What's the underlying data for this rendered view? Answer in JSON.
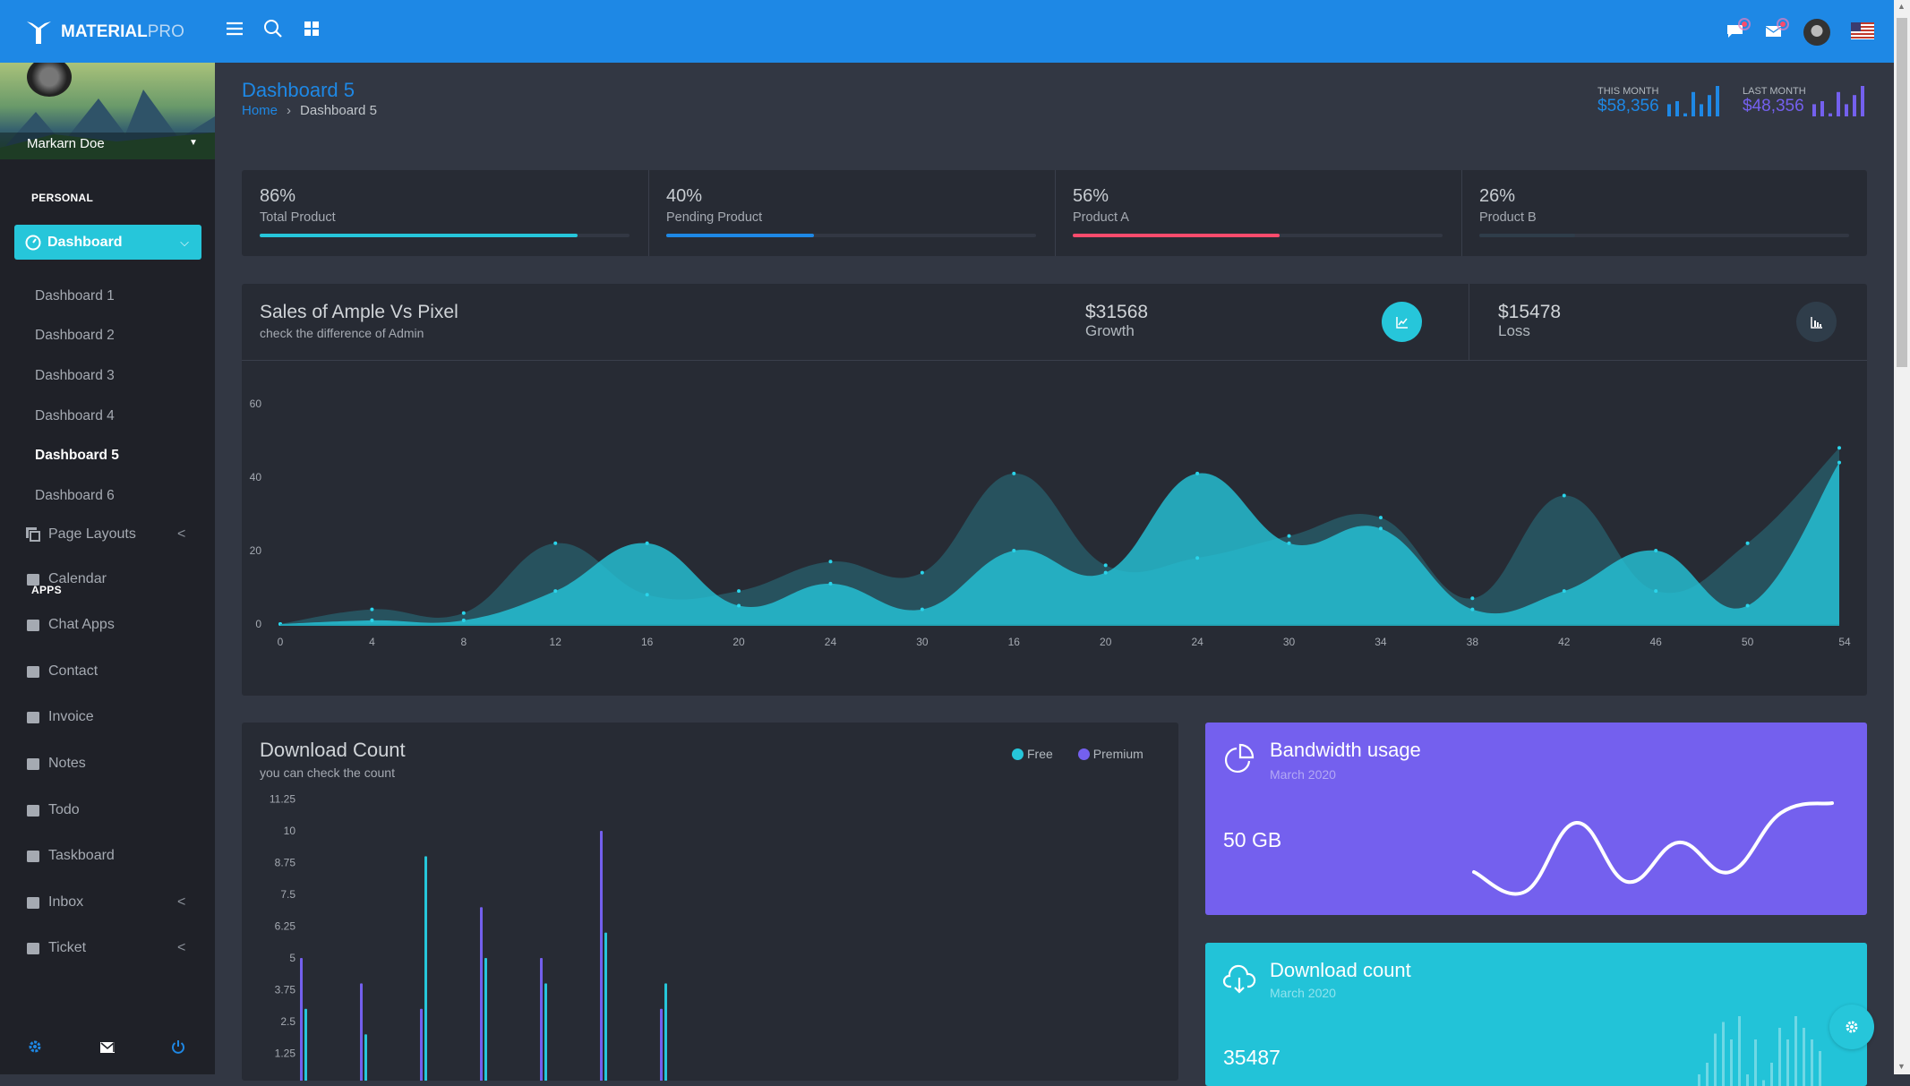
{
  "brand": {
    "name_bold": "MATERIAL",
    "name_light": "PRO"
  },
  "topbar": {
    "icons": [
      "menu-icon",
      "search-icon",
      "apps-grid-icon",
      "chat-icon",
      "mail-icon",
      "avatar",
      "us-flag-icon"
    ],
    "accent": "#1e88e5"
  },
  "page": {
    "title": "Dashboard 5",
    "breadcrumb": {
      "home": "Home",
      "current": "Dashboard 5"
    }
  },
  "month_stats": {
    "this_month": {
      "label": "THIS MONTH",
      "value": "$58,356",
      "bars": [
        4,
        5,
        1,
        8,
        4,
        7,
        10
      ],
      "color": "#1e88e5"
    },
    "last_month": {
      "label": "LAST MONTH",
      "value": "$48,356",
      "bars": [
        4,
        5,
        1,
        8,
        4,
        7,
        10
      ],
      "color": "#7460ee"
    }
  },
  "sidebar": {
    "user": "Markarn Doe",
    "personal": "PERSONAL",
    "dashboard": "Dashboard",
    "sub": [
      "Dashboard 1",
      "Dashboard 2",
      "Dashboard 3",
      "Dashboard 4",
      "Dashboard 5",
      "Dashboard 6"
    ],
    "active_sub": "Dashboard 5",
    "page_layouts": "Page Layouts",
    "apps": "APPS",
    "app_items": [
      "Calendar",
      "Chat Apps",
      "Contact",
      "Invoice",
      "Notes",
      "Todo",
      "Taskboard",
      "Inbox",
      "Ticket"
    ]
  },
  "stats": [
    {
      "percent": "86%",
      "label": "Total Product",
      "value": 86,
      "color": "#26c6da"
    },
    {
      "percent": "40%",
      "label": "Pending Product",
      "value": 40,
      "color": "#1e88e5"
    },
    {
      "percent": "56%",
      "label": "Product A",
      "value": 56,
      "color": "#fc4b6c"
    },
    {
      "percent": "26%",
      "label": "Product B",
      "value": 26,
      "color": "#2f3d4a"
    }
  ],
  "sales": {
    "title": "Sales of Ample Vs Pixel",
    "subtitle": "check the difference of Admin",
    "growth_value": "$31568",
    "growth_label": "Growth",
    "loss_value": "$15478",
    "loss_label": "Loss"
  },
  "chart_data": [
    {
      "type": "area",
      "categories": [
        "0",
        "4",
        "8",
        "12",
        "16",
        "20",
        "24",
        "30",
        "16",
        "20",
        "24",
        "30",
        "34",
        "38",
        "42",
        "46",
        "50",
        "54"
      ],
      "ylim": [
        0,
        60
      ],
      "yticks": [
        0,
        20,
        40,
        60
      ],
      "series": [
        {
          "values": [
            0,
            4,
            3,
            22,
            8,
            9,
            17,
            14,
            41,
            16,
            18,
            24,
            29,
            7,
            35,
            9,
            22,
            48
          ],
          "color": "#26c6da",
          "opacity": 0.25
        },
        {
          "values": [
            0,
            1,
            1,
            9,
            22,
            5,
            11,
            4,
            20,
            14,
            41,
            22,
            26,
            4,
            9,
            20,
            5,
            44
          ],
          "color": "#26c6da",
          "opacity": 0.8
        }
      ]
    },
    {
      "type": "bar",
      "title": "Download Count",
      "subtitle": "you can check the count",
      "yticks": [
        "11.25",
        "10",
        "8.75",
        "7.5",
        "6.25",
        "5",
        "3.75",
        "2.5",
        "1.25"
      ],
      "series": [
        {
          "name": "Free",
          "color": "#26c6da",
          "values": [
            3,
            2,
            9,
            5,
            4,
            6,
            4
          ]
        },
        {
          "name": "Premium",
          "color": "#7460ee",
          "values": [
            5,
            4,
            3,
            7,
            5,
            10,
            3
          ]
        }
      ]
    }
  ],
  "bandwidth": {
    "title": "Bandwidth usage",
    "date": "March 2020",
    "value": "50 GB",
    "color": "#7460ee",
    "spark": [
      3,
      1,
      8,
      2,
      6,
      3,
      9,
      10
    ]
  },
  "download": {
    "title": "Download count",
    "date": "March 2020",
    "value": "35487",
    "color": "#22c3d8",
    "spark": [
      2,
      4,
      9,
      11,
      8,
      12,
      2,
      8,
      1,
      4,
      10,
      8,
      12,
      10,
      8,
      6
    ]
  }
}
